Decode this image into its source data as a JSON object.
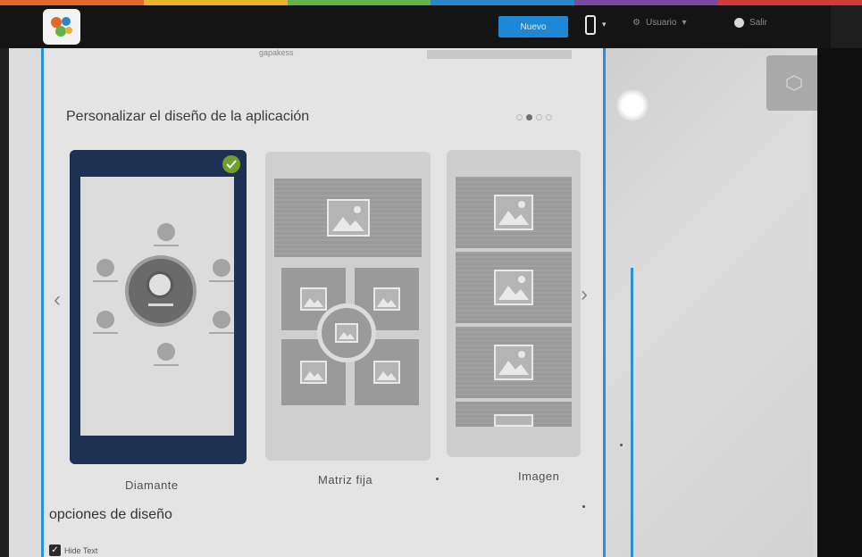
{
  "colors": {
    "accent": "#1e88d6",
    "frame_blue": "#2b8fd6",
    "selected_card": "#1d3253",
    "badge_green": "#6ea12a",
    "stripe": [
      "#e2682a",
      "#e9b12c",
      "#63b147",
      "#2a86c9",
      "#7a4aa0",
      "#d23b3b"
    ]
  },
  "topbar": {
    "new_button_label": "Nuevo",
    "device_icon": "mobile-phone-icon",
    "user_menu_label": "Usuario",
    "logout_label": "Salir"
  },
  "partial_header_text": "gapakess",
  "section": {
    "title": "Personalizar el diseño de la aplicación",
    "carousel_pages": 4,
    "carousel_active_index": 1
  },
  "layouts": [
    {
      "label": "Diamante",
      "selected": true
    },
    {
      "label": "Matriz fija",
      "selected": false
    },
    {
      "label": "Imagen",
      "selected": false
    }
  ],
  "options": {
    "title": "opciones de diseño",
    "hide_text_label": "Hide Text",
    "hide_text_checked": true
  }
}
